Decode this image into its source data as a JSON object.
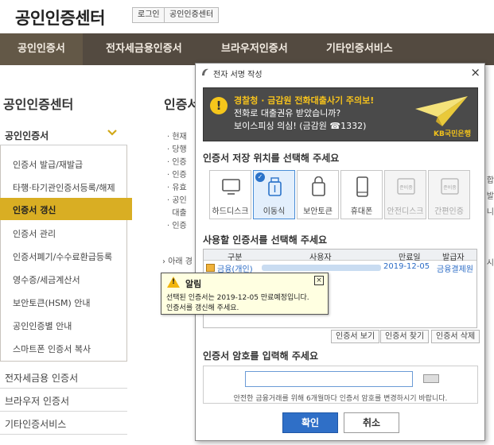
{
  "header": {
    "site_title": "공인인증센터",
    "login": "로그인",
    "cert_center": "공인인증센터"
  },
  "gnb": [
    "공인인증서",
    "전자세금용인증서",
    "브라우저인증서",
    "기타인증서비스"
  ],
  "sidebar": {
    "title": "공인인증센터",
    "section": "공인인증서",
    "items": [
      "인증서 발급/재발급",
      "타행·타기관인증서등록/해제",
      "인증서 갱신",
      "인증서 관리",
      "인증서폐기/수수료환급등록",
      "영수증/세금계산서",
      "보안토큰(HSM) 안내",
      "공인인증별 안내",
      "스마트폰 인증서 복사"
    ],
    "main_items": [
      "전자세금용 인증서",
      "브라우저 인증서",
      "기타인증서비스"
    ]
  },
  "content": {
    "title": "인증서",
    "bullets": [
      "현재",
      "당행",
      "인증",
      "인증",
      "유효",
      "공인",
      "대출",
      "인증"
    ],
    "note": "아래 경"
  },
  "modal": {
    "title": "전자 서명 작성",
    "close": "×",
    "banner": {
      "line1": "경찰청 · 금감원 전화대출사기 주의보!",
      "line2": "전화로 대출권유 받았습니까?",
      "line3": "보이스피싱 의심! (금감원 ☎1332)",
      "brand": "KB국민은행"
    },
    "storage_title": "인증서 저장 위치를 선택해 주세요",
    "devices": [
      {
        "label": "하드디스크",
        "icon": "monitor-icon"
      },
      {
        "label": "이동식",
        "icon": "usb-icon"
      },
      {
        "label": "보안토큰",
        "icon": "token-icon"
      },
      {
        "label": "휴대폰",
        "icon": "phone-icon"
      },
      {
        "label": "안전디스크",
        "icon": "safe-disk-icon"
      },
      {
        "label": "간편인증",
        "icon": "simple-auth-icon"
      }
    ],
    "disabled_tag": "준비중",
    "select_title": "사용할 인증서를 선택해 주세요",
    "table": {
      "headers": [
        "구분",
        "사용자",
        "만료일",
        "발급자"
      ],
      "row": {
        "type": "금융(개인)",
        "expiry": "2019-12-05",
        "issuer": "금융결제원"
      }
    },
    "buttons": {
      "view": "인증서 보기",
      "find": "인증서 찾기",
      "delete": "인증서 삭제"
    },
    "password_title": "인증서 암호를 입력해 주세요",
    "password_help": "안전한 금융거래를 위해 6개월마다 인증서 암호를 변경하시기 바랍니다.",
    "ok": "확인",
    "cancel": "취소"
  },
  "alert": {
    "title": "알림",
    "close": "×",
    "line1": "선택된 인증서는 2019-12-05 만료예정입니다.",
    "line2": "인증서를 갱신해 주세요."
  },
  "right_fragments": [
    "합",
    "발",
    "니",
    "시"
  ],
  "colors": {
    "gnb": "#534a40",
    "accent": "#d9ae23",
    "primary": "#2f6fc7"
  }
}
